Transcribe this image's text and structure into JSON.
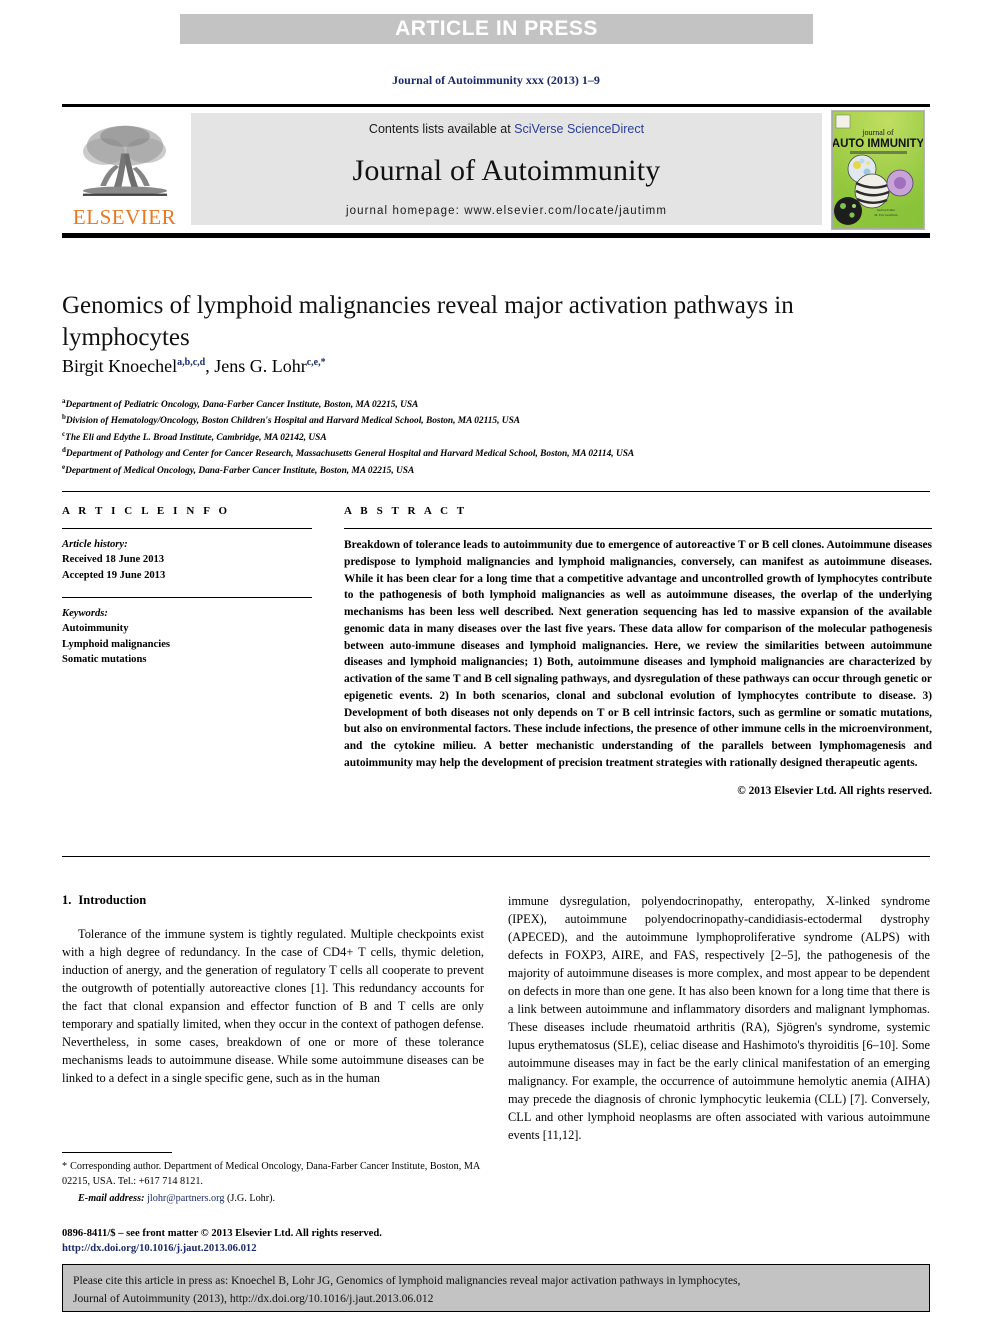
{
  "banner": {
    "label": "ARTICLE IN PRESS"
  },
  "running_head": "Journal of Autoimmunity xxx (2013) 1–9",
  "masthead": {
    "publisher": "ELSEVIER",
    "contents_prefix": "Contents lists available at ",
    "contents_link": "SciVerse ScienceDirect",
    "journal_name": "Journal of Autoimmunity",
    "homepage": "journal homepage: www.elsevier.com/locate/jautimm",
    "cover_line1": "journal of",
    "cover_line2": "AUTO IMMUNITY",
    "cover_sub": "a journal of translational immunology"
  },
  "article": {
    "title": "Genomics of lymphoid malignancies reveal major activation pathways in lymphocytes",
    "authors": [
      {
        "name": "Birgit Knoechel",
        "sup": "a,b,c,d"
      },
      {
        "name": "Jens G. Lohr",
        "sup": "c,e,*"
      }
    ],
    "author_separator": ", ",
    "affiliations": [
      {
        "mark": "a",
        "text": "Department of Pediatric Oncology, Dana-Farber Cancer Institute, Boston, MA 02215, USA"
      },
      {
        "mark": "b",
        "text": "Division of Hematology/Oncology, Boston Children's Hospital and Harvard Medical School, Boston, MA 02115, USA"
      },
      {
        "mark": "c",
        "text": "The Eli and Edythe L. Broad Institute, Cambridge, MA 02142, USA"
      },
      {
        "mark": "d",
        "text": "Department of Pathology and Center for Cancer Research, Massachusetts General Hospital and Harvard Medical School, Boston, MA 02114, USA"
      },
      {
        "mark": "e",
        "text": "Department of Medical Oncology, Dana-Farber Cancer Institute, Boston, MA 02215, USA"
      }
    ]
  },
  "article_info": {
    "heading": "A R T I C L E  I N F O",
    "history_label": "Article history:",
    "history": [
      "Received 18 June 2013",
      "Accepted 19 June 2013"
    ],
    "keywords_label": "Keywords:",
    "keywords": [
      "Autoimmunity",
      "Lymphoid malignancies",
      "Somatic mutations"
    ]
  },
  "abstract": {
    "heading": "A B S T R A C T",
    "body": "Breakdown of tolerance leads to autoimmunity due to emergence of autoreactive T or B cell clones. Autoimmune diseases predispose to lymphoid malignancies and lymphoid malignancies, conversely, can manifest as autoimmune diseases. While it has been clear for a long time that a competitive advantage and uncontrolled growth of lymphocytes contribute to the pathogenesis of both lymphoid malignancies as well as autoimmune diseases, the overlap of the underlying mechanisms has been less well described. Next generation sequencing has led to massive expansion of the available genomic data in many diseases over the last five years. These data allow for comparison of the molecular pathogenesis between auto-immune diseases and lymphoid malignancies. Here, we review the similarities between autoimmune diseases and lymphoid malignancies; 1) Both, autoimmune diseases and lymphoid malignancies are characterized by activation of the same T and B cell signaling pathways, and dysregulation of these pathways can occur through genetic or epigenetic events. 2) In both scenarios, clonal and subclonal evolution of lymphocytes contribute to disease. 3) Development of both diseases not only depends on T or B cell intrinsic factors, such as germline or somatic mutations, but also on environmental factors. These include infections, the presence of other immune cells in the microenvironment, and the cytokine milieu. A better mechanistic understanding of the parallels between lymphomagenesis and autoimmunity may help the development of precision treatment strategies with rationally designed therapeutic agents.",
    "copyright": "© 2013 Elsevier Ltd. All rights reserved."
  },
  "introduction": {
    "number": "1.",
    "heading": "Introduction",
    "left_paragraph": "Tolerance of the immune system is tightly regulated. Multiple checkpoints exist with a high degree of redundancy. In the case of CD4+ T cells, thymic deletion, induction of anergy, and the generation of regulatory T cells all cooperate to prevent the outgrowth of potentially autoreactive clones [1]. This redundancy accounts for the fact that clonal expansion and effector function of B and T cells are only temporary and spatially limited, when they occur in the context of pathogen defense. Nevertheless, in some cases, breakdown of one or more of these tolerance mechanisms leads to autoimmune disease. While some autoimmune diseases can be linked to a defect in a single specific gene, such as in the human",
    "right_paragraph": "immune dysregulation, polyendocrinopathy, enteropathy, X-linked syndrome (IPEX), autoimmune polyendocrinopathy-candidiasis-ectodermal dystrophy (APECED), and the autoimmune lymphoproliferative syndrome (ALPS) with defects in FOXP3, AIRE, and FAS, respectively [2–5], the pathogenesis of the majority of autoimmune diseases is more complex, and most appear to be dependent on defects in more than one gene. It has also been known for a long time that there is a link between autoimmune and inflammatory disorders and malignant lymphomas. These diseases include rheumatoid arthritis (RA), Sjögren's syndrome, systemic lupus erythematosus (SLE), celiac disease and Hashimoto's thyroiditis [6–10]. Some autoimmune diseases may in fact be the early clinical manifestation of an emerging malignancy. For example, the occurrence of autoimmune hemolytic anemia (AIHA) may precede the diagnosis of chronic lymphocytic leukemia (CLL) [7]. Conversely, CLL and other lymphoid neoplasms are often associated with various autoimmune events [11,12]."
  },
  "footnote": {
    "star": "*",
    "corresponding": "Corresponding author. Department of Medical Oncology, Dana-Farber Cancer Institute, Boston, MA 02215, USA. Tel.: +617 714 8121.",
    "email_label": "E-mail address:",
    "email": "jlohr@partners.org",
    "email_owner": "(J.G. Lohr)."
  },
  "frontmatter": {
    "line1": "0896-8411/$ – see front matter © 2013 Elsevier Ltd. All rights reserved.",
    "doi": "http://dx.doi.org/10.1016/j.jaut.2013.06.012"
  },
  "cite_box": {
    "line1": "Please cite this article in press as: Knoechel B, Lohr JG, Genomics of lymphoid malignancies reveal major activation pathways in lymphocytes,",
    "line2": "Journal of Autoimmunity (2013), http://dx.doi.org/10.1016/j.jaut.2013.06.012"
  },
  "colors": {
    "banner_bg": "#c3c3c3",
    "link_blue": "#1b2a6b",
    "sciencedirect_blue": "#2b3f96",
    "elsevier_orange": "#e87722",
    "masthead_panel": "#e4e4e4"
  }
}
